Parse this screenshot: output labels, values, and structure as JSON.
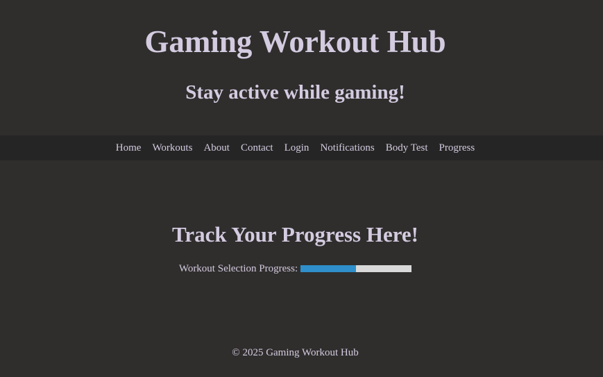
{
  "header": {
    "title": "Gaming Workout Hub",
    "tagline": "Stay active while gaming!"
  },
  "nav": {
    "items": [
      {
        "label": "Home"
      },
      {
        "label": "Workouts"
      },
      {
        "label": "About"
      },
      {
        "label": "Contact"
      },
      {
        "label": "Login"
      },
      {
        "label": "Notifications"
      },
      {
        "label": "Body Test"
      },
      {
        "label": "Progress"
      }
    ]
  },
  "main": {
    "heading": "Track Your Progress Here!",
    "progress_label": "Workout Selection Progress:",
    "progress_value": 0.5,
    "progress_fill_color": "#2e8fca",
    "progress_track_color": "#d9d9d9"
  },
  "footer": {
    "text": "© 2025 Gaming Workout Hub"
  },
  "colors": {
    "background": "#302e2d",
    "nav_background": "#262525",
    "text": "#d3cbe0"
  }
}
